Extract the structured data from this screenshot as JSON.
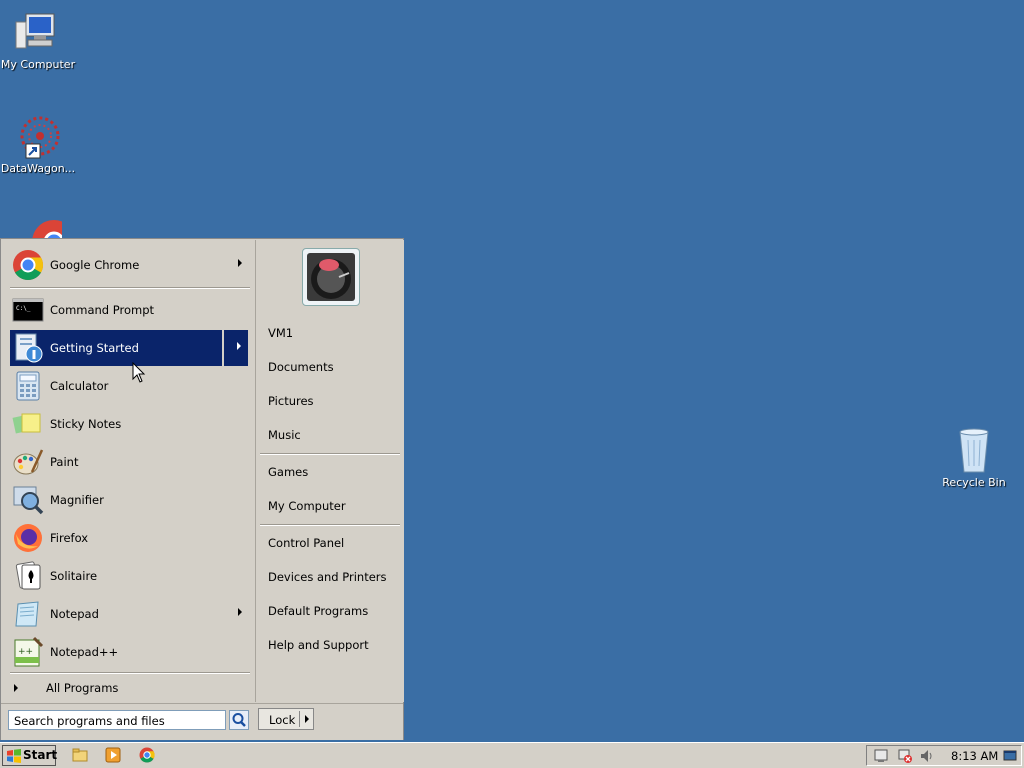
{
  "desktop": {
    "icons": [
      {
        "label": "My Computer"
      },
      {
        "label": "DataWagon..."
      },
      {
        "label": "Recycle Bin"
      }
    ]
  },
  "start_menu": {
    "pinned": [
      {
        "label": "Google Chrome",
        "icon": "chrome-icon",
        "has_submenu": true
      }
    ],
    "recent": [
      {
        "label": "Command Prompt",
        "icon": "command-prompt-icon",
        "has_submenu": false
      },
      {
        "label": "Getting Started",
        "icon": "getting-started-icon",
        "has_submenu": true,
        "highlighted": true
      },
      {
        "label": "Calculator",
        "icon": "calculator-icon",
        "has_submenu": false
      },
      {
        "label": "Sticky Notes",
        "icon": "sticky-notes-icon",
        "has_submenu": false
      },
      {
        "label": "Paint",
        "icon": "paint-icon",
        "has_submenu": false
      },
      {
        "label": "Magnifier",
        "icon": "magnifier-icon",
        "has_submenu": false
      },
      {
        "label": "Firefox",
        "icon": "firefox-icon",
        "has_submenu": false
      },
      {
        "label": "Solitaire",
        "icon": "solitaire-icon",
        "has_submenu": false
      },
      {
        "label": "Notepad",
        "icon": "notepad-icon",
        "has_submenu": true
      },
      {
        "label": "Notepad++",
        "icon": "notepad-plus-plus-icon",
        "has_submenu": false
      }
    ],
    "all_programs": "All Programs",
    "right": {
      "group1": [
        "VM1",
        "Documents",
        "Pictures",
        "Music"
      ],
      "group2": [
        "Games",
        "My Computer"
      ],
      "group3": [
        "Control Panel",
        "Devices and Printers",
        "Default Programs",
        "Help and Support"
      ]
    },
    "search": {
      "value": "Search programs and files"
    },
    "lock_label": "Lock"
  },
  "taskbar": {
    "start_label": "Start",
    "clock": "8:13 AM"
  },
  "colors": {
    "desktop": "#3a6ea5",
    "highlight": "#0a246a",
    "menu_bg": "#d4d0c8"
  }
}
